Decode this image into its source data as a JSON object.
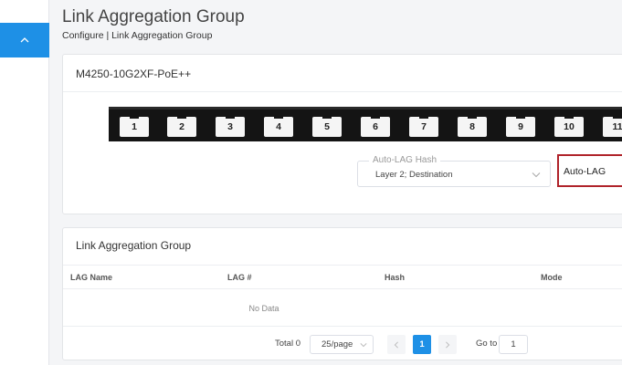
{
  "header": {
    "title": "Link Aggregation Group",
    "breadcrumb": "Configure | Link Aggregation Group"
  },
  "device": {
    "name": "M4250-10G2XF-PoE++",
    "ports": [
      "1",
      "2",
      "3",
      "4",
      "5",
      "6",
      "7",
      "8",
      "9",
      "10",
      "11"
    ]
  },
  "auto_lag_hash": {
    "label": "Auto-LAG Hash",
    "value": "Layer 2; Destination"
  },
  "mode_box": {
    "value": "Auto-LAG"
  },
  "lag_table": {
    "title": "Link Aggregation Group",
    "columns": [
      "LAG Name",
      "LAG #",
      "Hash",
      "Mode"
    ],
    "empty_text": "No Data"
  },
  "pagination": {
    "total_label": "Total 0",
    "page_size": "25/page",
    "current_page": "1",
    "goto_label": "Go to",
    "goto_value": "1"
  },
  "colors": {
    "accent": "#1e90e6",
    "highlight_border": "#b0232a"
  }
}
